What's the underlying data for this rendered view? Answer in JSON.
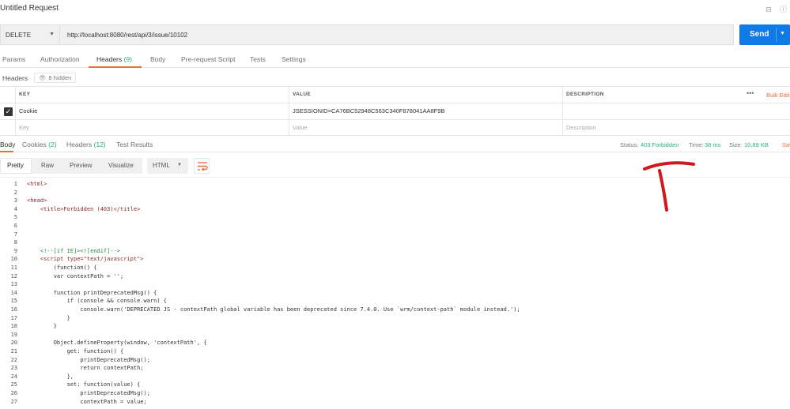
{
  "window": {
    "title": "Untitled Request",
    "right_icons": "⊟ ⓘ"
  },
  "request": {
    "method": "DELETE",
    "url": "http://localhost:8080/rest/api/3/issue/10102",
    "send_label": "Send"
  },
  "request_tabs": [
    {
      "label": "Params",
      "count": ""
    },
    {
      "label": "Authorization",
      "count": ""
    },
    {
      "label": "Headers",
      "count": "(9)"
    },
    {
      "label": "Body",
      "count": ""
    },
    {
      "label": "Pre-request Script",
      "count": ""
    },
    {
      "label": "Tests",
      "count": ""
    },
    {
      "label": "Settings",
      "count": ""
    }
  ],
  "headers_section": {
    "label": "Headers",
    "hidden_label": "8 hidden"
  },
  "headers_table": {
    "columns": [
      "KEY",
      "VALUE",
      "DESCRIPTION"
    ],
    "more_label": "•••",
    "bulk_edit_label": "Bulk Edit",
    "rows": [
      {
        "key": "Cookie",
        "value": "JSESSIONID=CA76BC52948C563C340F878041AA8F9B",
        "description": ""
      }
    ],
    "placeholders": {
      "key": "Key",
      "value": "Value",
      "description": "Description"
    }
  },
  "response_tabs": [
    {
      "label": "Body",
      "count": ""
    },
    {
      "label": "Cookies",
      "count": "(2)"
    },
    {
      "label": "Headers",
      "count": "(12)"
    },
    {
      "label": "Test Results",
      "count": ""
    }
  ],
  "response_meta": {
    "status_label": "Status:",
    "status_value": "403 Forbidden",
    "time_label": "Time:",
    "time_value": "38 ms",
    "size_label": "Size:",
    "size_value": "10.89 KB",
    "save_label": "Save"
  },
  "format_bar": {
    "modes": [
      "Pretty",
      "Raw",
      "Preview",
      "Visualize"
    ],
    "language": "HTML"
  },
  "code_lines": [
    "<html>",
    "",
    "<head>",
    "    <title>Forbidden (403)</title>",
    "",
    "",
    "",
    "",
    "    <!--[if IE]><![endif]-->",
    "    <script type=\"text/javascript\">",
    "        (function() {",
    "        var contextPath = '';",
    "",
    "        function printDeprecatedMsg() {",
    "            if (console && console.warn) {",
    "                console.warn('DEPRECATED JS - contextPath global variable has been deprecated since 7.4.0. Use `wrm/context-path` module instead.');",
    "            }",
    "        }",
    "",
    "        Object.defineProperty(window, 'contextPath', {",
    "            get: function() {",
    "                printDeprecatedMsg();",
    "                return contextPath;",
    "            },",
    "            set: function(value) {",
    "                printDeprecatedMsg();",
    "                contextPath = value;"
  ],
  "colors": {
    "accent": "#f26b3a",
    "send": "#0f7ae5",
    "success": "#26b47f",
    "annotation": "#d0191f"
  }
}
